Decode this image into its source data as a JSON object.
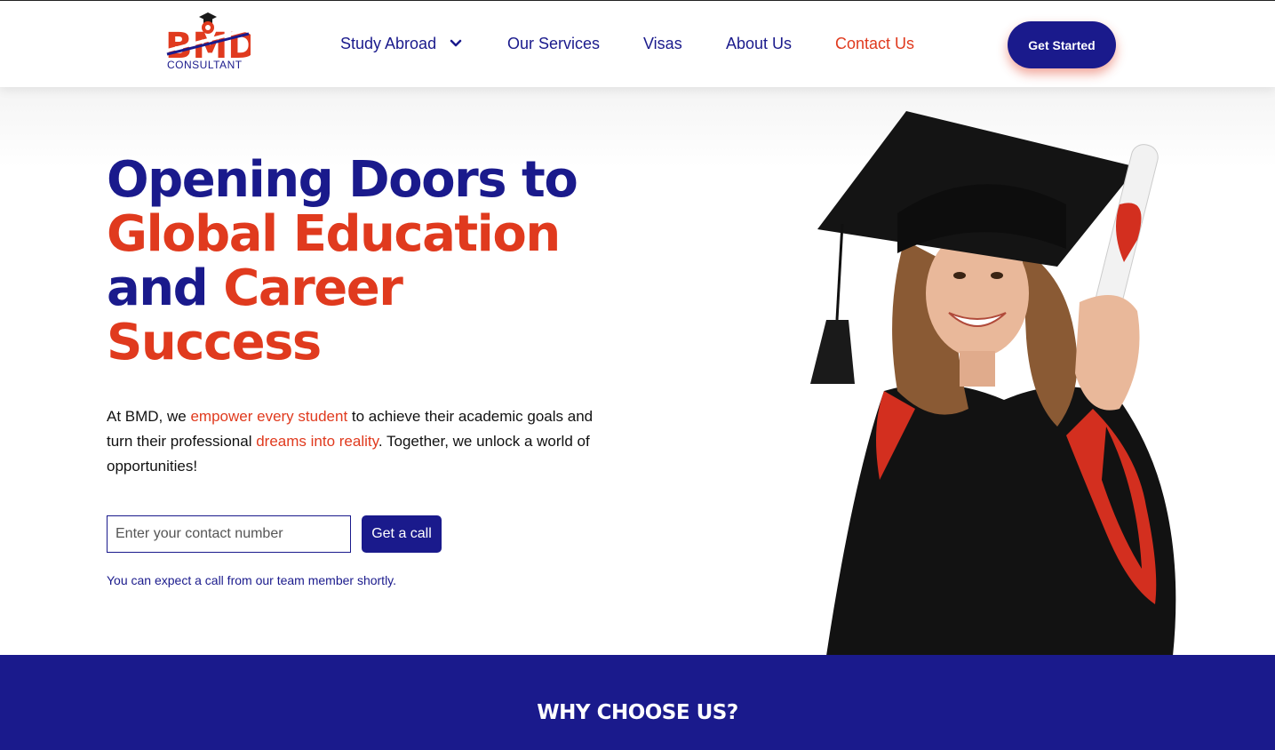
{
  "brand": {
    "logo_text": "BMD",
    "logo_subtext": "CONSULTANT",
    "primary_color": "#1a1a8c",
    "accent_color": "#e03a1e"
  },
  "nav": {
    "items": [
      {
        "label": "Study Abroad",
        "has_dropdown": true
      },
      {
        "label": "Our Services"
      },
      {
        "label": "Visas"
      },
      {
        "label": "About Us"
      },
      {
        "label": "Contact Us",
        "active": true
      }
    ],
    "cta_label": "Get Started"
  },
  "hero": {
    "headline": {
      "line1": "Opening Doors to",
      "line2": "Global Education",
      "line3_part1": "and ",
      "line3_part2": "Career",
      "line4": "Success"
    },
    "intro": {
      "part1": "At BMD, we ",
      "highlight1": "empower every student",
      "part2": " to achieve their academic goals and turn their professional ",
      "highlight2": "dreams into reality",
      "part3": ". Together, we unlock a world of opportunities!"
    },
    "contact_placeholder": "Enter your contact number",
    "call_button_label": "Get a call",
    "call_note": "You can expect a call from our team member shortly."
  },
  "why_section": {
    "title": "WHY CHOOSE US?"
  }
}
